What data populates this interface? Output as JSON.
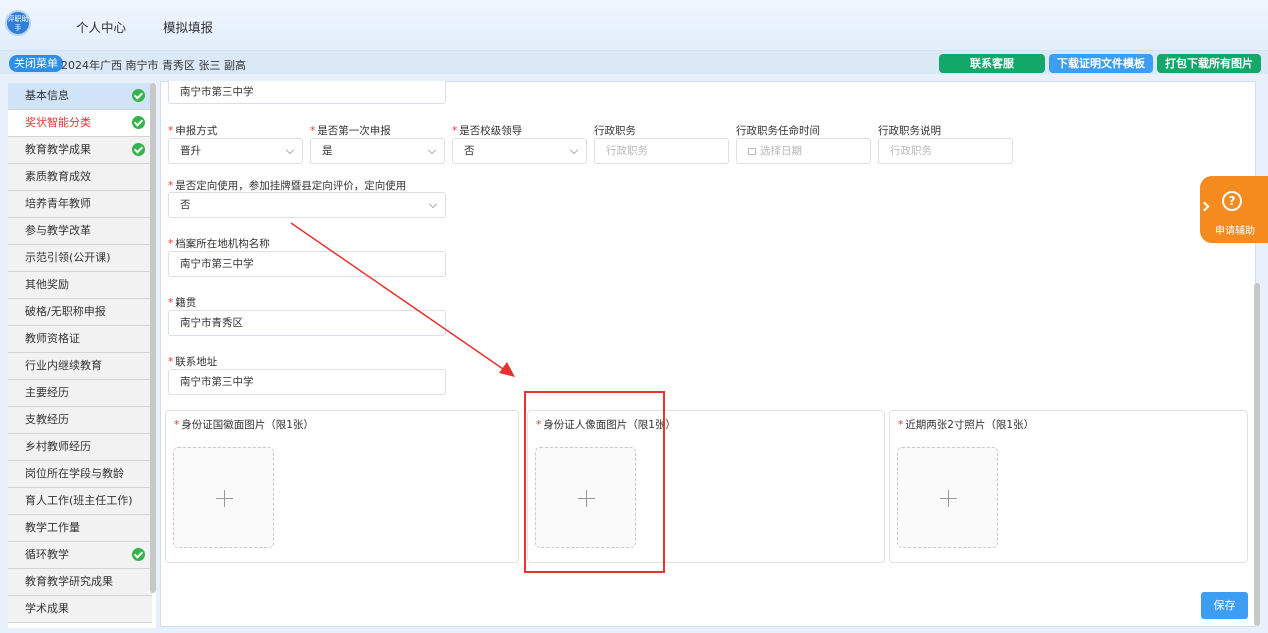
{
  "header": {
    "logo_text": "评职助手",
    "nav": [
      "个人中心",
      "模拟填报"
    ]
  },
  "subbar": {
    "menu_toggle": "关闭菜单",
    "info": "2024年广西 南宁市 青秀区 张三 副高",
    "buttons": [
      "联系客服",
      "下载证明文件模板",
      "打包下载所有图片"
    ]
  },
  "sidebar": {
    "items": [
      {
        "label": "基本信息",
        "checked": true,
        "state": "active"
      },
      {
        "label": "奖状智能分类",
        "checked": true,
        "state": "red"
      },
      {
        "label": "教育教学成果",
        "checked": true,
        "state": ""
      },
      {
        "label": "素质教育成效",
        "checked": false,
        "state": ""
      },
      {
        "label": "培养青年教师",
        "checked": false,
        "state": ""
      },
      {
        "label": "参与教学改革",
        "checked": false,
        "state": ""
      },
      {
        "label": "示范引领(公开课)",
        "checked": false,
        "state": ""
      },
      {
        "label": "其他奖励",
        "checked": false,
        "state": ""
      },
      {
        "label": "破格/无职称申报",
        "checked": false,
        "state": ""
      },
      {
        "label": "教师资格证",
        "checked": false,
        "state": ""
      },
      {
        "label": "行业内继续教育",
        "checked": false,
        "state": ""
      },
      {
        "label": "主要经历",
        "checked": false,
        "state": ""
      },
      {
        "label": "支教经历",
        "checked": false,
        "state": ""
      },
      {
        "label": "乡村教师经历",
        "checked": false,
        "state": ""
      },
      {
        "label": "岗位所在学段与教龄",
        "checked": false,
        "state": ""
      },
      {
        "label": "育人工作(班主任工作)",
        "checked": false,
        "state": ""
      },
      {
        "label": "教学工作量",
        "checked": false,
        "state": ""
      },
      {
        "label": "循环教学",
        "checked": true,
        "state": ""
      },
      {
        "label": "教育教学研究成果",
        "checked": false,
        "state": ""
      },
      {
        "label": "学术成果",
        "checked": false,
        "state": ""
      }
    ]
  },
  "form": {
    "school_top": "南宁市第三中学",
    "apply_method": {
      "label": "申报方式",
      "value": "晋升"
    },
    "first_apply": {
      "label": "是否第一次申报",
      "value": "是"
    },
    "school_leader": {
      "label": "是否校级领导",
      "value": "否"
    },
    "admin_post": {
      "label": "行政职务",
      "placeholder": "行政职务"
    },
    "admin_post_time": {
      "label": "行政职务任命时间",
      "placeholder": "选择日期"
    },
    "admin_post_desc": {
      "label": "行政职务说明",
      "placeholder": "行政职务"
    },
    "directed": {
      "label": "是否定向使用，参加挂牌暨县定向评价，定向使用",
      "value": "否"
    },
    "archive_org": {
      "label": "档案所在地机构名称",
      "value": "南宁市第三中学"
    },
    "native_place": {
      "label": "籍贯",
      "value": "南宁市青秀区"
    },
    "address": {
      "label": "联系地址",
      "value": "南宁市第三中学"
    },
    "uploads": [
      {
        "title": "身份证国徽面图片（限1张）"
      },
      {
        "title": "身份证人像面图片（限1张）"
      },
      {
        "title": "近期两张2寸照片（限1张）"
      }
    ],
    "save_label": "保存"
  },
  "assist": {
    "label": "申请辅助",
    "icon": "question-icon"
  },
  "colors": {
    "accent_blue": "#3d9df0",
    "green": "#13a86a",
    "orange": "#f58a1f",
    "annotation_red": "#e8322f"
  }
}
